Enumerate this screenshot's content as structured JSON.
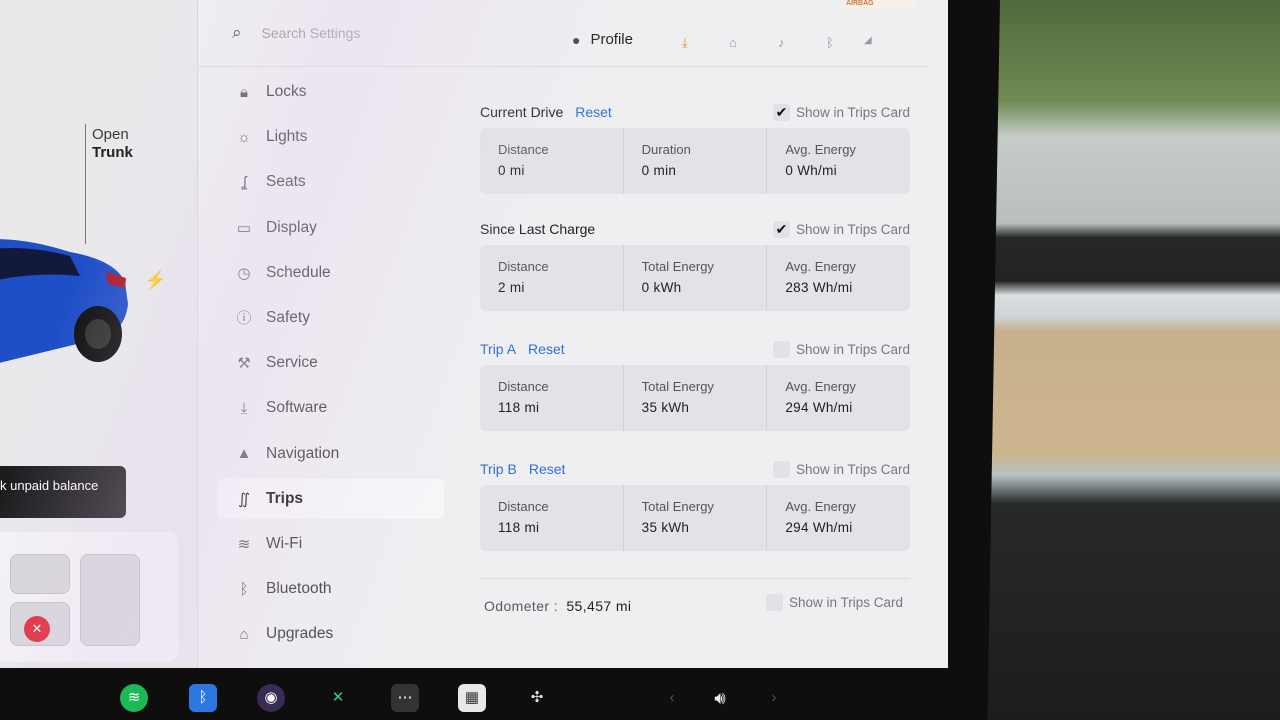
{
  "colors": {
    "accent": "#2f6fd8",
    "screen_bg": "#efeff1",
    "card_bg": "#e3e3e7",
    "alert_red": "#e0202e"
  },
  "airbag_badge": "AIRBAG",
  "car_panel": {
    "open_label": "Open",
    "trunk_label": "Trunk",
    "balance_text": "k unpaid balance",
    "icons": [
      "charge-bolt-icon",
      "seatbelt-warning-icon"
    ]
  },
  "topbar": {
    "search_placeholder": "Search Settings",
    "profile_label": "Profile",
    "status_icons": [
      "download-icon",
      "homelink-icon",
      "bell-icon",
      "bluetooth-icon",
      "lte-signal-icon"
    ]
  },
  "nav": {
    "items": [
      {
        "label": "Locks",
        "icon": "lock-icon"
      },
      {
        "label": "Lights",
        "icon": "sun-icon"
      },
      {
        "label": "Seats",
        "icon": "seat-icon"
      },
      {
        "label": "Display",
        "icon": "display-icon"
      },
      {
        "label": "Schedule",
        "icon": "clock-icon"
      },
      {
        "label": "Safety",
        "icon": "alert-icon"
      },
      {
        "label": "Service",
        "icon": "wrench-icon"
      },
      {
        "label": "Software",
        "icon": "download-icon"
      },
      {
        "label": "Navigation",
        "icon": "navigation-icon"
      },
      {
        "label": "Trips",
        "icon": "trips-icon",
        "active": true
      },
      {
        "label": "Wi-Fi",
        "icon": "wifi-icon"
      },
      {
        "label": "Bluetooth",
        "icon": "bluetooth-icon"
      },
      {
        "label": "Upgrades",
        "icon": "bag-icon"
      }
    ]
  },
  "trips": {
    "show_label": "Show in Trips Card",
    "reset_label": "Reset",
    "sections": [
      {
        "title": "Current Drive",
        "has_reset": true,
        "show_checked": true,
        "cells": [
          {
            "label": "Distance",
            "value": "0 mi"
          },
          {
            "label": "Duration",
            "value": "0 min"
          },
          {
            "label": "Avg. Energy",
            "value": "0 Wh/mi"
          }
        ]
      },
      {
        "title": "Since Last Charge",
        "has_reset": false,
        "show_checked": true,
        "cells": [
          {
            "label": "Distance",
            "value": "2 mi"
          },
          {
            "label": "Total Energy",
            "value": "0 kWh"
          },
          {
            "label": "Avg. Energy",
            "value": "283 Wh/mi"
          }
        ]
      },
      {
        "title": "Trip A",
        "has_reset": true,
        "show_checked": false,
        "cells": [
          {
            "label": "Distance",
            "value": "118 mi"
          },
          {
            "label": "Total Energy",
            "value": "35 kWh"
          },
          {
            "label": "Avg. Energy",
            "value": "294 Wh/mi"
          }
        ]
      },
      {
        "title": "Trip B",
        "has_reset": true,
        "show_checked": false,
        "cells": [
          {
            "label": "Distance",
            "value": "118 mi"
          },
          {
            "label": "Total Energy",
            "value": "35 kWh"
          },
          {
            "label": "Avg. Energy",
            "value": "294 Wh/mi"
          }
        ]
      }
    ],
    "odometer": {
      "label": "Odometer",
      "separator": ":",
      "value": "55,457 mi",
      "show_checked": false
    }
  },
  "dock": [
    "spotify-icon",
    "bluetooth-icon",
    "camera-icon",
    "toybox-icon",
    "more-icon",
    "calendar-icon",
    "fan-icon",
    "chevron-left-icon",
    "volume-icon",
    "chevron-right-icon"
  ]
}
